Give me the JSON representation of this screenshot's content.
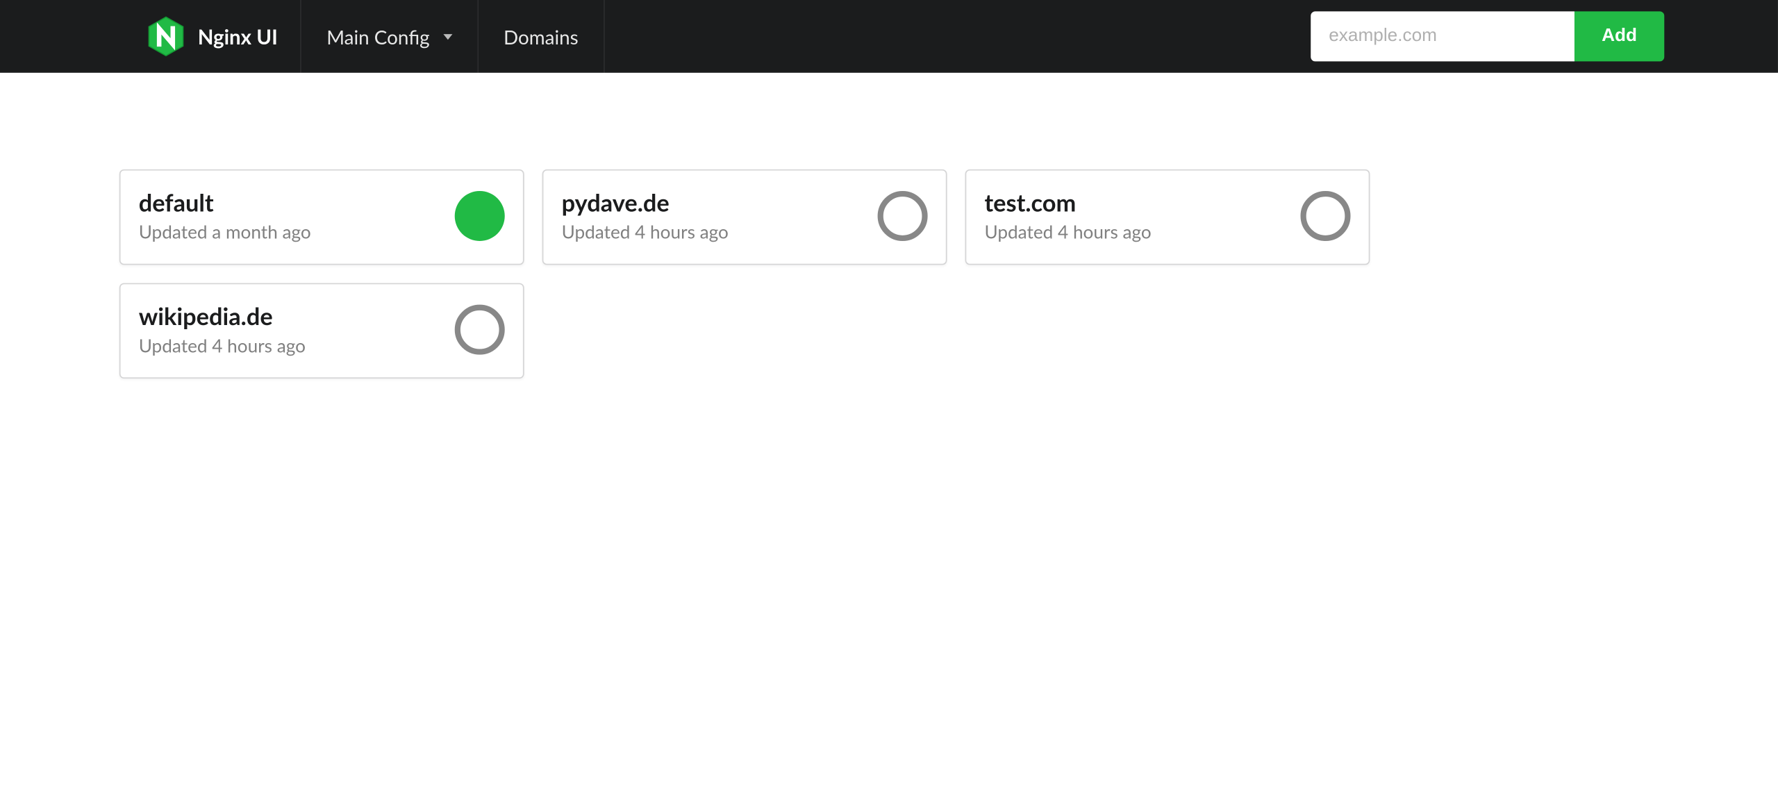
{
  "nav": {
    "brand": "Nginx UI",
    "main_config": "Main Config",
    "domains": "Domains",
    "add_placeholder": "example.com",
    "add_button": "Add"
  },
  "cards": [
    {
      "name": "default",
      "updated": "Updated a month ago",
      "active": true
    },
    {
      "name": "pydave.de",
      "updated": "Updated 4 hours ago",
      "active": false
    },
    {
      "name": "test.com",
      "updated": "Updated 4 hours ago",
      "active": false
    },
    {
      "name": "wikipedia.de",
      "updated": "Updated 4 hours ago",
      "active": false
    }
  ],
  "colors": {
    "accent": "#21ba45",
    "navbar": "#1b1c1d",
    "muted": "#808080"
  }
}
